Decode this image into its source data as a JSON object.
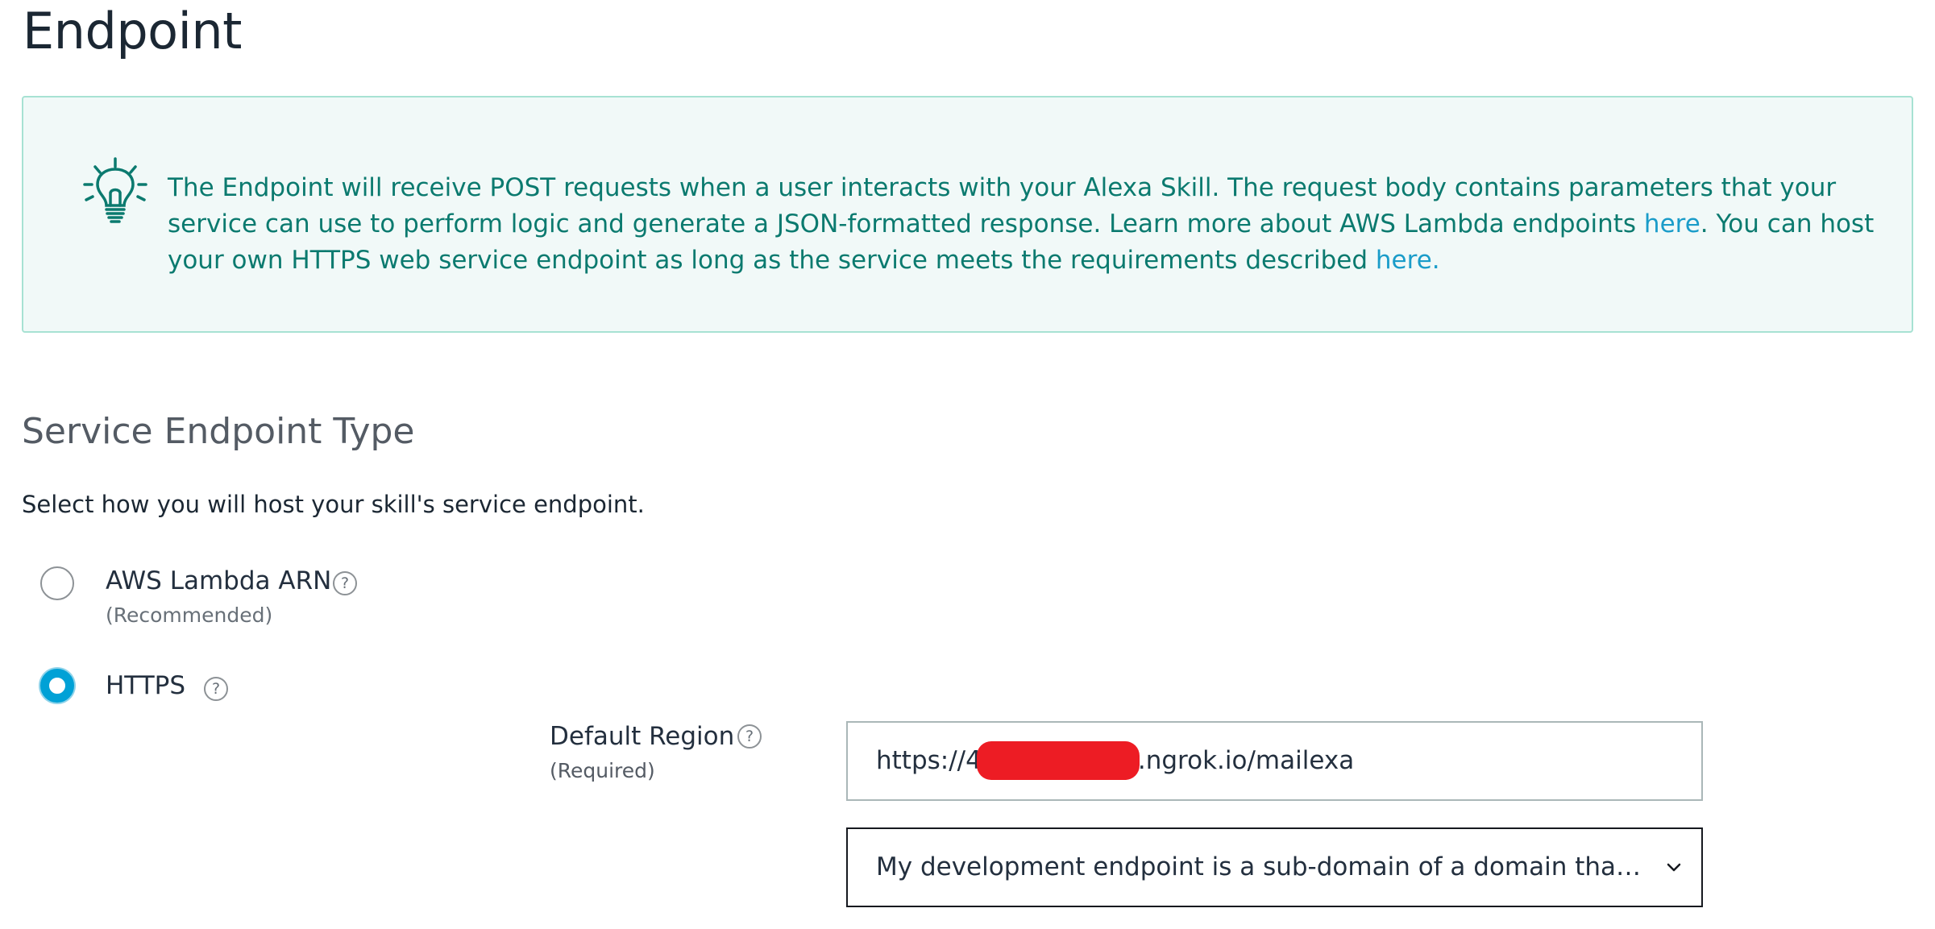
{
  "page": {
    "title": "Endpoint"
  },
  "info": {
    "text_1": "The Endpoint will receive POST requests when a user interacts with your Alexa Skill. The request body contains parameters that your service can use to perform logic and generate a JSON-formatted response. Learn more about AWS Lambda endpoints ",
    "link_1": "here",
    "text_2": ". You can host your own HTTPS web service endpoint as long as the service meets the requirements described ",
    "link_2": "here.",
    "icon": "lightbulb-icon",
    "colors": {
      "text": "#0b7a6f",
      "link": "#1a9cc9",
      "background": "#f1f9f8",
      "border": "#a7e2d3"
    }
  },
  "service_endpoint": {
    "title": "Service Endpoint Type",
    "description": "Select how you will host your skill's service endpoint.",
    "options": [
      {
        "label": "AWS Lambda ARN",
        "sublabel": "(Recommended)",
        "selected": false
      },
      {
        "label": "HTTPS",
        "selected": true
      }
    ],
    "help_glyph": "?",
    "accent_color": "#00a1d6"
  },
  "default_region": {
    "label": "Default Region",
    "sublabel": "(Required)",
    "url_prefix": "https://",
    "url_partial_char": "4",
    "url_suffix": ".ngrok.io/mailexa",
    "certificate_option": "My development endpoint is a sub-domain of a domain that has a wildcard certificate from a certificate authority"
  }
}
